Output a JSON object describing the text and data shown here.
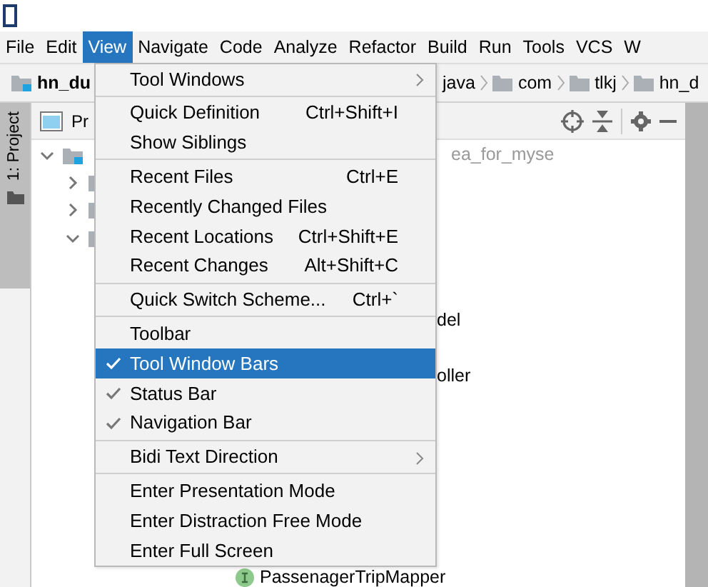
{
  "menubar": [
    {
      "label": "File",
      "selected": false
    },
    {
      "label": "Edit",
      "selected": false
    },
    {
      "label": "View",
      "selected": true
    },
    {
      "label": "Navigate",
      "selected": false
    },
    {
      "label": "Code",
      "selected": false
    },
    {
      "label": "Analyze",
      "selected": false
    },
    {
      "label": "Refactor",
      "selected": false
    },
    {
      "label": "Build",
      "selected": false
    },
    {
      "label": "Run",
      "selected": false
    },
    {
      "label": "Tools",
      "selected": false
    },
    {
      "label": "VCS",
      "selected": false
    },
    {
      "label": "W",
      "selected": false
    }
  ],
  "navigation_bar": [
    {
      "label": "hn_du",
      "kind": "project"
    },
    {
      "label": "java",
      "kind": "folder"
    },
    {
      "label": "com",
      "kind": "folder"
    },
    {
      "label": "tlkj",
      "kind": "folder"
    },
    {
      "label": "hn_d",
      "kind": "folder"
    }
  ],
  "tool_strip": {
    "tab": "1: Project"
  },
  "project_panel": {
    "title": "Pr",
    "tree": [
      {
        "kind": "folder",
        "expanded": true,
        "text": "ea_for_myse"
      },
      {
        "kind": "folder",
        "expanded": false
      },
      {
        "kind": "folder",
        "expanded": false
      },
      {
        "kind": "folder",
        "expanded": true
      },
      {
        "kind": "blank"
      },
      {
        "kind": "blank"
      },
      {
        "kind": "fragment",
        "text": "del"
      },
      {
        "kind": "blank"
      },
      {
        "kind": "fragment",
        "text": "oller"
      },
      {
        "kind": "blank"
      },
      {
        "kind": "blank"
      },
      {
        "kind": "blank"
      },
      {
        "kind": "blank"
      },
      {
        "kind": "blank"
      },
      {
        "kind": "blank"
      },
      {
        "kind": "interface",
        "text": "PassenagerTripMapper"
      }
    ]
  },
  "menu": [
    {
      "kind": "item",
      "label": "Tool Windows",
      "submenu": true,
      "checked": false,
      "selected": false
    },
    {
      "kind": "separator"
    },
    {
      "kind": "item",
      "label": "Quick Definition",
      "shortcut": "Ctrl+Shift+I",
      "checked": false,
      "selected": false
    },
    {
      "kind": "item",
      "label": "Show Siblings",
      "checked": false,
      "selected": false
    },
    {
      "kind": "separator"
    },
    {
      "kind": "item",
      "label": "Recent Files",
      "shortcut": "Ctrl+E",
      "checked": false,
      "selected": false
    },
    {
      "kind": "item",
      "label": "Recently Changed Files",
      "checked": false,
      "selected": false
    },
    {
      "kind": "item",
      "label": "Recent Locations",
      "shortcut": "Ctrl+Shift+E",
      "checked": false,
      "selected": false
    },
    {
      "kind": "item",
      "label": "Recent Changes",
      "shortcut": "Alt+Shift+C",
      "checked": false,
      "selected": false
    },
    {
      "kind": "separator"
    },
    {
      "kind": "item",
      "label": "Quick Switch Scheme...",
      "shortcut": "Ctrl+`",
      "checked": false,
      "selected": false
    },
    {
      "kind": "separator"
    },
    {
      "kind": "item",
      "label": "Toolbar",
      "checked": false,
      "selected": false
    },
    {
      "kind": "item",
      "label": "Tool Window Bars",
      "checked": true,
      "selected": true
    },
    {
      "kind": "item",
      "label": "Status Bar",
      "checked": true,
      "selected": false
    },
    {
      "kind": "item",
      "label": "Navigation Bar",
      "checked": true,
      "selected": false
    },
    {
      "kind": "separator"
    },
    {
      "kind": "item",
      "label": "Bidi Text Direction",
      "submenu": true,
      "checked": false,
      "selected": false
    },
    {
      "kind": "separator"
    },
    {
      "kind": "item",
      "label": "Enter Presentation Mode",
      "checked": false,
      "selected": false
    },
    {
      "kind": "item",
      "label": "Enter Distraction Free Mode",
      "checked": false,
      "selected": false
    },
    {
      "kind": "item",
      "label": "Enter Full Screen",
      "checked": false,
      "selected": false
    }
  ]
}
